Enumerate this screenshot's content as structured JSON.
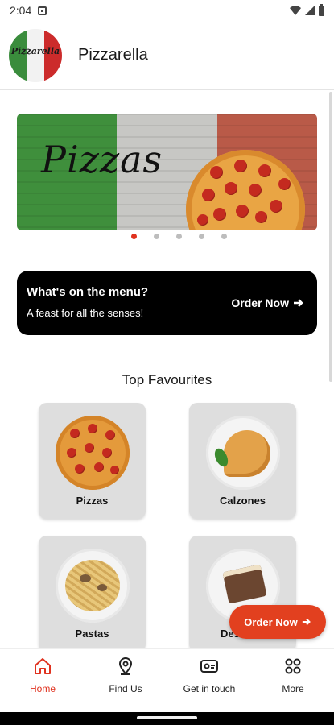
{
  "status_bar": {
    "time": "2:04"
  },
  "header": {
    "app_name": "Pizzarella",
    "logo_text": "Pizzarella"
  },
  "banner": {
    "title": "Pizzas",
    "slide_count": 5,
    "active_slide": 1
  },
  "menu_card": {
    "heading": "What's on the menu?",
    "subheading": "A feast for all the senses!",
    "order_label": "Order Now"
  },
  "favourites": {
    "title": "Top Favourites",
    "items": [
      {
        "label": "Pizzas"
      },
      {
        "label": "Calzones"
      },
      {
        "label": "Pastas"
      },
      {
        "label": "Desserts"
      }
    ]
  },
  "fab": {
    "label": "Order Now"
  },
  "nav": {
    "items": [
      {
        "label": "Home",
        "icon": "home-icon"
      },
      {
        "label": "Find Us",
        "icon": "location-pin-icon"
      },
      {
        "label": "Get in touch",
        "icon": "contact-card-icon"
      },
      {
        "label": "More",
        "icon": "grid-icon"
      }
    ],
    "active": "Home"
  },
  "colors": {
    "accent": "#e0321f",
    "card_bg": "#dedede",
    "menu_card_bg": "#000000"
  }
}
